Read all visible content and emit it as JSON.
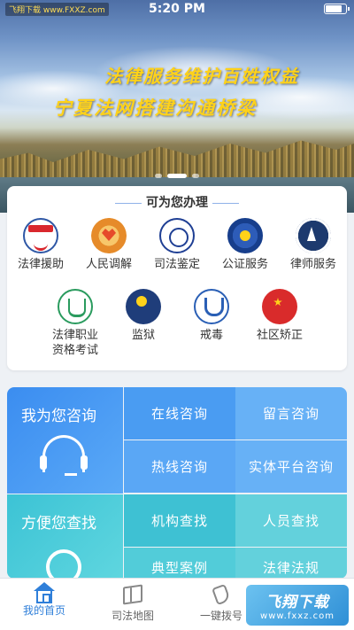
{
  "status": {
    "left_tag": "飞翔下载 www.FXXZ.com",
    "time": "5:20 PM"
  },
  "banner": {
    "slogan_1": "法律服务维护百姓权益",
    "slogan_2": "宁夏法网搭建沟通桥梁",
    "slide_count": 3,
    "active_slide": 1
  },
  "services": {
    "title": "可为您办理",
    "items": [
      {
        "label": "法律援助",
        "icon": "legal-aid-icon"
      },
      {
        "label": "人民调解",
        "icon": "mediation-icon"
      },
      {
        "label": "司法鉴定",
        "icon": "judicial-appraisal-icon"
      },
      {
        "label": "公证服务",
        "icon": "notary-icon"
      },
      {
        "label": "律师服务",
        "icon": "lawyer-icon"
      },
      {
        "label": "法律职业\n资格考试",
        "icon": "exam-icon"
      },
      {
        "label": "监狱",
        "icon": "prison-icon"
      },
      {
        "label": "戒毒",
        "icon": "rehab-icon"
      },
      {
        "label": "社区矫正",
        "icon": "community-correction-icon"
      }
    ]
  },
  "grid": {
    "consult": {
      "title": "我为您咨询",
      "items": [
        "在线咨询",
        "留言咨询",
        "热线咨询",
        "实体平台咨询"
      ]
    },
    "find": {
      "title": "方便您查找",
      "items": [
        "机构查找",
        "人员查找",
        "典型案例",
        "法律法规"
      ]
    }
  },
  "tabbar": {
    "tabs": [
      {
        "label": "我的首页",
        "active": true
      },
      {
        "label": "司法地图",
        "active": false
      },
      {
        "label": "一键拨号",
        "active": false
      },
      {
        "label": "",
        "active": false
      }
    ]
  },
  "watermark": {
    "title": "飞翔下载",
    "url": "www.fxxz.com"
  },
  "colors": {
    "accent": "#2f7fd9",
    "consult_blue": "#4a9cf2",
    "find_cyan": "#3ec1d3",
    "slogan_yellow": "#ffd21a"
  }
}
